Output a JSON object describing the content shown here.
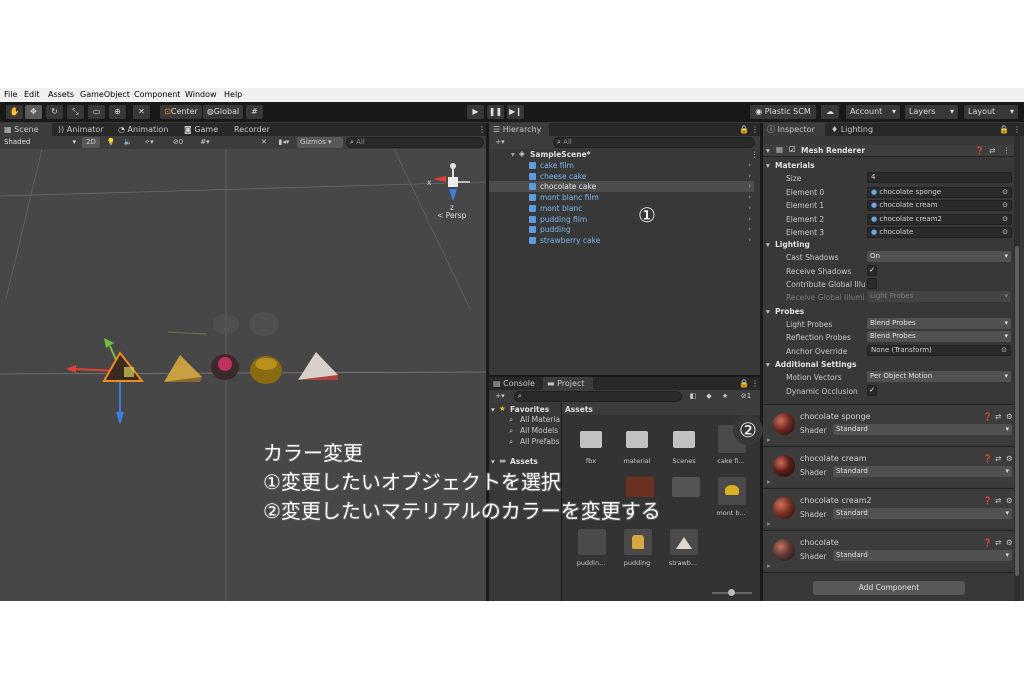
{
  "menu": [
    "File",
    "Edit",
    "Assets",
    "GameObject",
    "Component",
    "Window",
    "Help"
  ],
  "toolbar": {
    "center": "Center",
    "global": "Global",
    "plastic": "Plastic SCM",
    "account": "Account",
    "layers": "Layers",
    "layout": "Layout"
  },
  "scene": {
    "tabs": [
      "Scene",
      "Animator",
      "Animation",
      "Game",
      "Recorder"
    ],
    "shading": "Shaded",
    "mode2d": "2D",
    "fx_count": "0",
    "gizmos": "Gizmos",
    "search_placeholder": "All",
    "persp": "Persp",
    "axis_x": "x",
    "axis_z": "z"
  },
  "hierarchy": {
    "tab": "Hierarchy",
    "search_placeholder": "All",
    "scene_name": "SampleScene*",
    "items": [
      "cake film",
      "cheese cake",
      "chocolate cake",
      "mont blanc film",
      "mont blanc",
      "pudding film",
      "pudding",
      "strawberry cake"
    ],
    "selected_index": 2
  },
  "project": {
    "tabs": [
      "Console",
      "Project"
    ],
    "favorites_label": "Favorites",
    "favorites": [
      "All Materia",
      "All Models",
      "All Prefabs"
    ],
    "assets_label": "Assets",
    "hidden_count": "1",
    "assets_header": "Assets",
    "asset_items": [
      "fbx",
      "material",
      "Scenes",
      "cake fi...",
      "",
      "",
      "",
      "mont b...",
      "puddin...",
      "pudding",
      "strawb..."
    ]
  },
  "inspector": {
    "tabs": [
      "Inspector",
      "Lighting"
    ],
    "component": "Mesh Renderer",
    "materials_label": "Materials",
    "size_label": "Size",
    "size_value": "4",
    "elements": [
      {
        "label": "Element 0",
        "value": "chocolate sponge"
      },
      {
        "label": "Element 1",
        "value": "chocolate cream"
      },
      {
        "label": "Element 2",
        "value": "chocolate cream2"
      },
      {
        "label": "Element 3",
        "value": "chocolate"
      }
    ],
    "lighting_label": "Lighting",
    "cast_shadows_label": "Cast Shadows",
    "cast_shadows": "On",
    "receive_shadows_label": "Receive Shadows",
    "contribute_gi_label": "Contribute Global Illu",
    "receive_gi_label": "Receive Global Illumi",
    "receive_gi": "Light Probes",
    "probes_label": "Probes",
    "light_probes_label": "Light Probes",
    "light_probes": "Blend Probes",
    "reflection_probes_label": "Reflection Probes",
    "reflection_probes": "Blend Probes",
    "anchor_label": "Anchor Override",
    "anchor_value": "None (Transform)",
    "additional_label": "Additional Settings",
    "motion_vectors_label": "Motion Vectors",
    "motion_vectors": "Per Object Motion",
    "dynamic_occlusion_label": "Dynamic Occlusion",
    "materials": [
      {
        "name": "chocolate sponge",
        "shader_label": "Shader",
        "shader": "Standard",
        "color": "#6e2a22"
      },
      {
        "name": "chocolate cream",
        "shader_label": "Shader",
        "shader": "Standard",
        "color": "#5a1d18"
      },
      {
        "name": "chocolate cream2",
        "shader_label": "Shader",
        "shader": "Standard",
        "color": "#7a3322"
      },
      {
        "name": "chocolate",
        "shader_label": "Shader",
        "shader": "Standard",
        "color": "#5a3a36"
      }
    ],
    "add_component": "Add Component"
  },
  "overlay": {
    "line1": "カラー変更",
    "line2": "①変更したいオブジェクトを選択",
    "line3": "②変更したいマテリアルのカラーを変更する",
    "marker1": "①",
    "marker2": "②"
  },
  "colors": {
    "selection": "#2c5d87",
    "link_blue": "#7db8f0",
    "accent_orange": "#f08a1c"
  }
}
